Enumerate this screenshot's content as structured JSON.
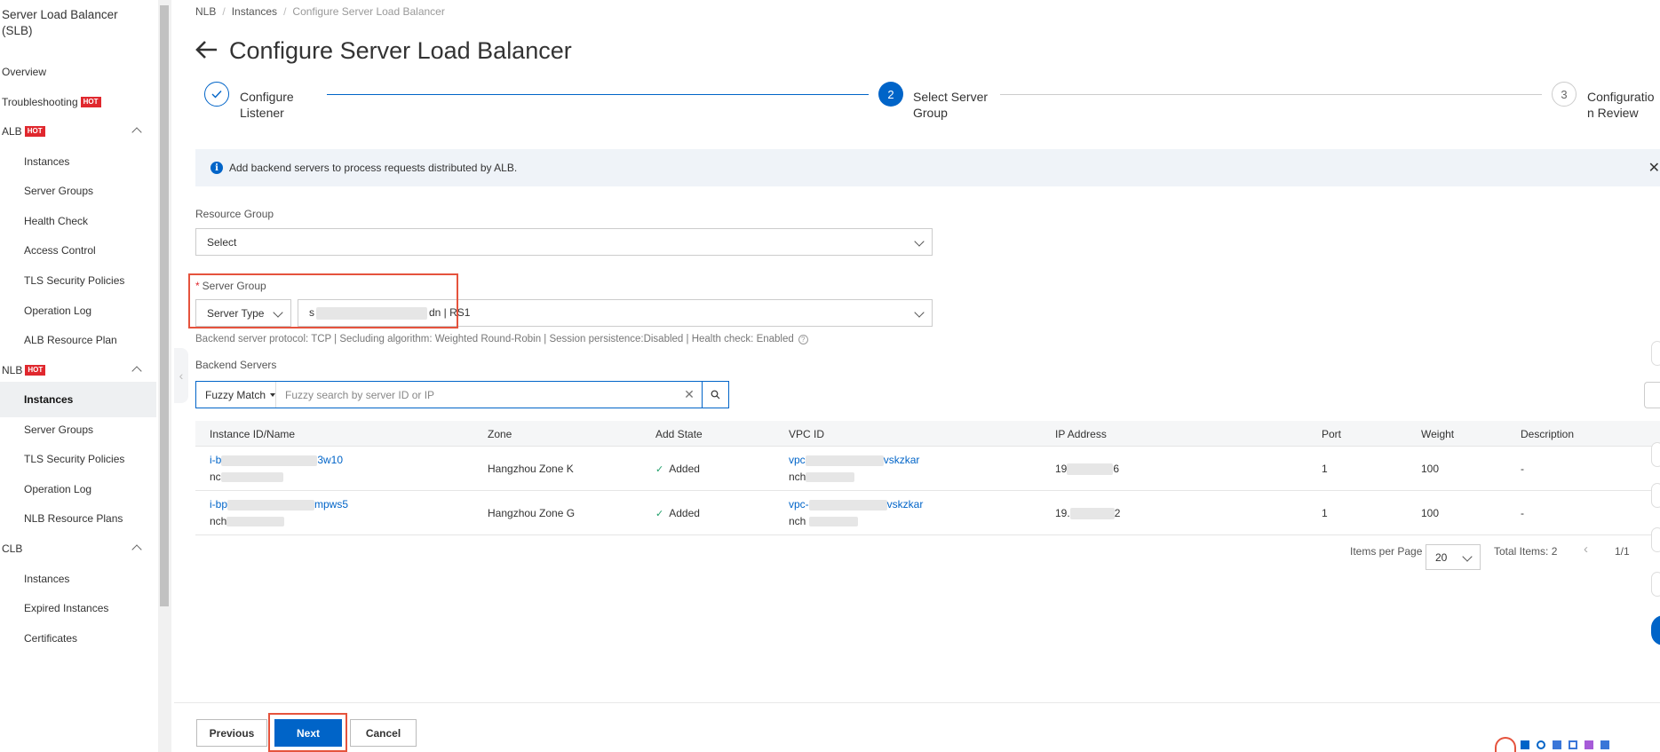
{
  "sidebar": {
    "title": "Server Load Balancer (SLB)",
    "items": [
      {
        "label": "Overview"
      },
      {
        "label": "Troubleshooting",
        "badge": "HOT"
      },
      {
        "label": "ALB",
        "badge": "HOT"
      },
      {
        "label": "Instances"
      },
      {
        "label": "Server Groups"
      },
      {
        "label": "Health Check"
      },
      {
        "label": "Access Control"
      },
      {
        "label": "TLS Security Policies"
      },
      {
        "label": "Operation Log"
      },
      {
        "label": "ALB Resource Plan"
      },
      {
        "label": "NLB",
        "badge": "HOT"
      },
      {
        "label": "Instances"
      },
      {
        "label": "Server Groups"
      },
      {
        "label": "TLS Security Policies"
      },
      {
        "label": "Operation Log"
      },
      {
        "label": "NLB Resource Plans"
      },
      {
        "label": "CLB"
      },
      {
        "label": "Instances"
      },
      {
        "label": "Expired Instances"
      },
      {
        "label": "Certificates"
      }
    ]
  },
  "breadcrumb": [
    "NLB",
    "Instances",
    "Configure Server Load Balancer"
  ],
  "page": {
    "title": "Configure Server Load Balancer"
  },
  "steps": [
    {
      "number": "",
      "label_line1": "Configure",
      "label_line2": "Listener",
      "status": "done"
    },
    {
      "number": "2",
      "label_line1": "Select Server",
      "label_line2": "Group",
      "status": "active"
    },
    {
      "number": "3",
      "label_line1": "Configuratio",
      "label_line2": "n Review",
      "status": "wait"
    }
  ],
  "info": {
    "text": "Add backend servers to process requests distributed by ALB."
  },
  "form": {
    "resource_group_label": "Resource Group",
    "resource_group_value": "Select",
    "server_group_label": "Server Group",
    "required_mark": "*",
    "server_type_value": "Server Type",
    "server_group_value_prefix": "s",
    "server_group_value_suffix": "dn | RS1",
    "helper_text": "Backend server protocol: TCP | Secluding algorithm: Weighted Round-Robin | Session persistence:Disabled | Health check: Enabled",
    "backend_servers_label": "Backend Servers",
    "search_mode": "Fuzzy Match",
    "search_placeholder": "Fuzzy search by server ID or IP"
  },
  "table": {
    "headers": [
      "Instance ID/Name",
      "Zone",
      "Add State",
      "VPC ID",
      "IP Address",
      "Port",
      "Weight",
      "Description"
    ],
    "rows": [
      {
        "id_prefix": "i-b",
        "id_suffix": "3w10",
        "name_prefix": "nc",
        "zone": "Hangzhou Zone K",
        "state": "Added",
        "vpc_prefix": "vpc",
        "vpc_suffix": "vskzkar",
        "vpc_name_prefix": "nch",
        "ip_prefix": "19",
        "ip_suffix": "6",
        "port": "1",
        "weight": "100",
        "description": "-"
      },
      {
        "id_prefix": "i-bp",
        "id_suffix": "mpws5",
        "name_prefix": "nch",
        "zone": "Hangzhou Zone G",
        "state": "Added",
        "vpc_prefix": "vpc-",
        "vpc_suffix": "vskzkar",
        "vpc_name_prefix": "nch",
        "ip_prefix": "19.",
        "ip_suffix": "2",
        "port": "1",
        "weight": "100",
        "description": "-"
      }
    ]
  },
  "pagination": {
    "items_per_page_label": "Items per Page",
    "page_size": "20",
    "total_label": "Total Items: 2",
    "page": "1/1"
  },
  "footer": {
    "previous": "Previous",
    "next": "Next",
    "cancel": "Cancel"
  },
  "colors": {
    "primary": "#0064c8",
    "hot": "#e0282e",
    "highlight_frame": "#e5533d"
  }
}
